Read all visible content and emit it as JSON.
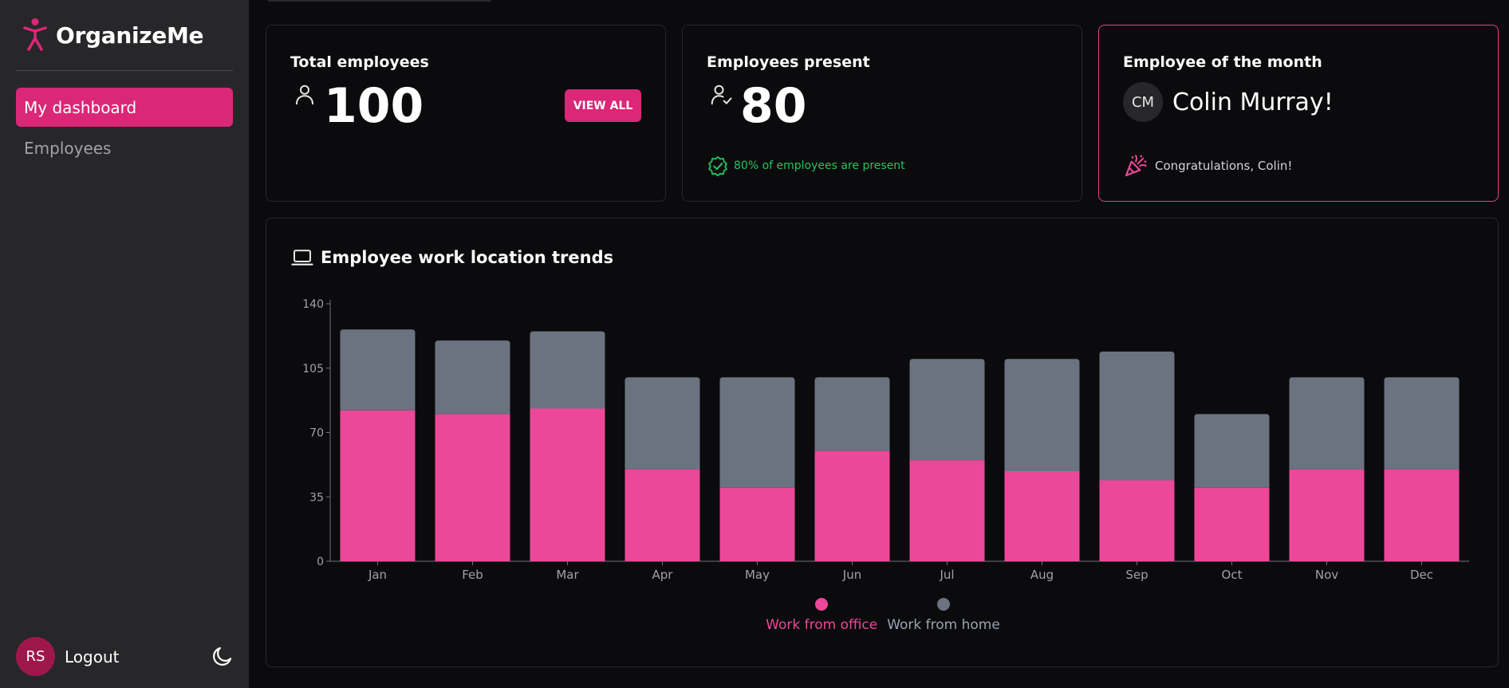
{
  "app": {
    "name": "OrganizeMe"
  },
  "sidebar": {
    "items": [
      {
        "label": "My dashboard",
        "active": true
      },
      {
        "label": "Employees",
        "active": false
      }
    ],
    "user": {
      "initials": "RS",
      "logout_label": "Logout"
    }
  },
  "cards": {
    "total": {
      "title": "Total employees",
      "value": "100",
      "button_label": "VIEW ALL"
    },
    "present": {
      "title": "Employees present",
      "value": "80",
      "note": "80% of employees are present"
    },
    "eom": {
      "title": "Employee of the month",
      "initials": "CM",
      "name": "Colin Murray!",
      "message": "Congratulations, Colin!"
    }
  },
  "colors": {
    "accent": "#db2777",
    "office": "#ec4899",
    "home": "#6b7280",
    "success": "#22c55e"
  },
  "chart_data": {
    "type": "bar",
    "stacked": true,
    "title": "Employee work location trends",
    "categories": [
      "Jan",
      "Feb",
      "Mar",
      "Apr",
      "May",
      "Jun",
      "Jul",
      "Aug",
      "Sep",
      "Oct",
      "Nov",
      "Dec"
    ],
    "series": [
      {
        "name": "Work from office",
        "color": "#ec4899",
        "values": [
          82,
          80,
          83,
          50,
          40,
          60,
          55,
          49,
          44,
          40,
          50,
          50
        ]
      },
      {
        "name": "Work from home",
        "color": "#6b7280",
        "values": [
          44,
          40,
          42,
          50,
          60,
          40,
          55,
          61,
          70,
          40,
          50,
          50
        ]
      }
    ],
    "ylim": [
      0,
      140
    ],
    "yticks": [
      0,
      35,
      70,
      105,
      140
    ],
    "legend": "bottom-center",
    "grid": false
  }
}
